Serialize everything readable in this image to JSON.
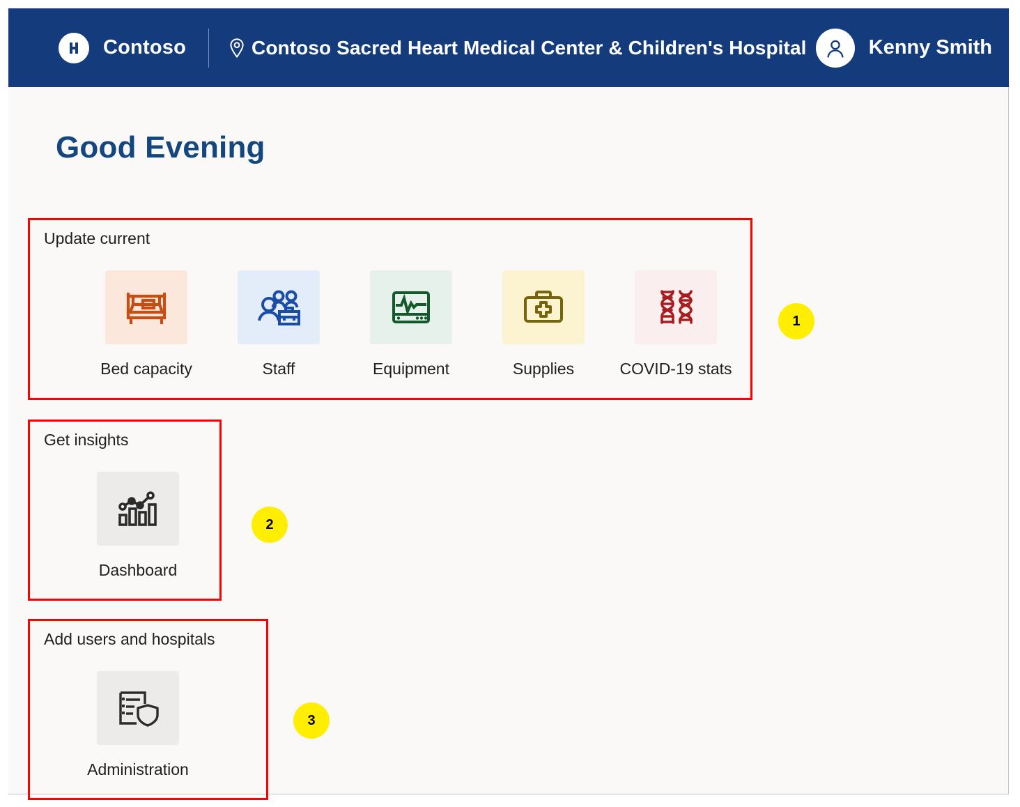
{
  "header": {
    "logo_icon": "hospital-h-logo",
    "brand": "Contoso",
    "location_icon": "location-pin-icon",
    "site_name": "Contoso Sacred Heart Medical Center & Children's Hospital",
    "avatar_icon": "user-avatar-icon",
    "user_name": "Kenny Smith",
    "background_color": "#143C7C"
  },
  "page": {
    "greeting": "Good Evening",
    "greeting_color": "#14467F",
    "background_color": "#faf9f7"
  },
  "sections": [
    {
      "title": "Update current",
      "tiles": [
        {
          "label": "Bed capacity",
          "icon": "bed-icon",
          "tile_bg": "#FCE7DC",
          "icon_color": "#C44F15"
        },
        {
          "label": "Staff",
          "icon": "staff-group-icon",
          "tile_bg": "#E3ECF9",
          "icon_color": "#1A4DA8"
        },
        {
          "label": "Equipment",
          "icon": "vitals-monitor-icon",
          "tile_bg": "#E7F1EB",
          "icon_color": "#14592C"
        },
        {
          "label": "Supplies",
          "icon": "first-aid-kit-icon",
          "tile_bg": "#FCF3D1",
          "icon_color": "#76650A"
        },
        {
          "label": "COVID-19 stats",
          "icon": "dna-helix-icon",
          "tile_bg": "#FAEEEE",
          "icon_color": "#A81E20"
        }
      ]
    },
    {
      "title": "Get insights",
      "tiles": [
        {
          "label": "Dashboard",
          "icon": "bar-chart-trend-icon",
          "tile_bg": "#EDEBE9",
          "icon_color": "#2b2b2b"
        }
      ]
    },
    {
      "title": "Add users and hospitals",
      "tiles": [
        {
          "label": "Administration",
          "icon": "clipboard-shield-icon",
          "tile_bg": "#EDEBE9",
          "icon_color": "#2b2b2b"
        }
      ]
    }
  ],
  "callouts": [
    {
      "number": "1",
      "color": "#ffee00"
    },
    {
      "number": "2",
      "color": "#ffee00"
    },
    {
      "number": "3",
      "color": "#ffee00"
    }
  ],
  "annotation_outline_color": "#ff0000"
}
